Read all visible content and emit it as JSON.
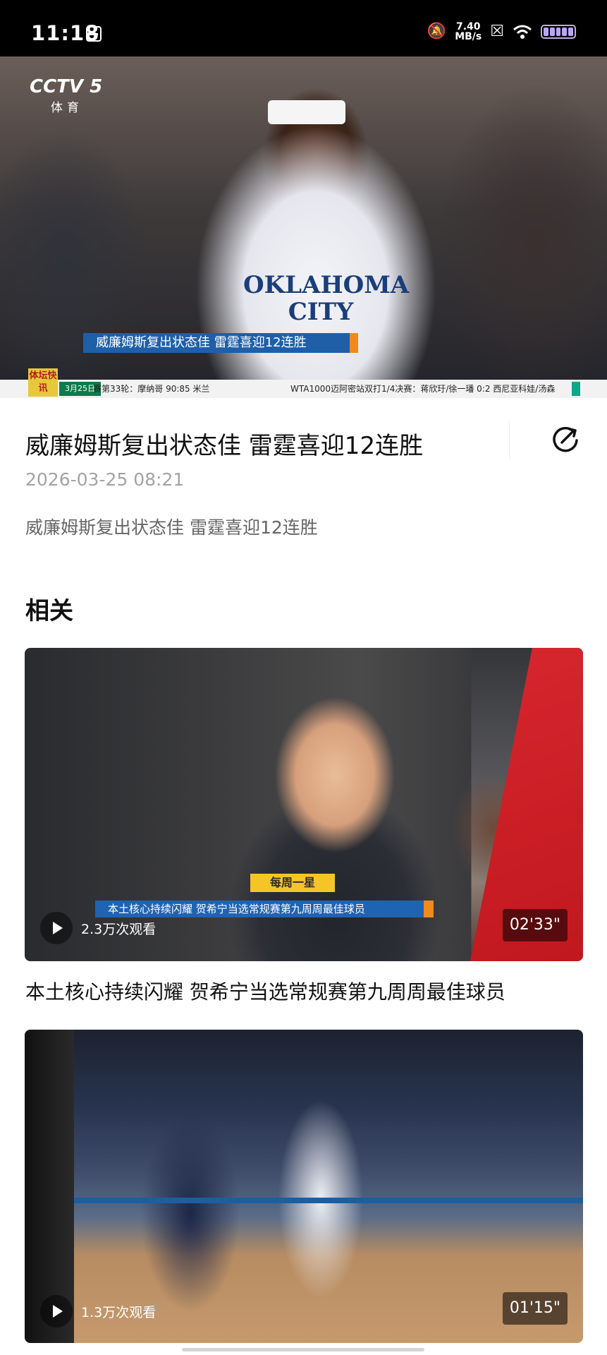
{
  "status_bar": {
    "time": "11:18",
    "net_speed_value": "7.40",
    "net_speed_unit": "MB/s",
    "icons": [
      "calendar-icon",
      "mute-icon",
      "x-app-icon",
      "wifi-icon",
      "battery-icon"
    ]
  },
  "hero_video": {
    "channel_logo": "CCTV 5",
    "channel_logo_sub": "体育",
    "jersey_text": [
      "OKLAHOMA",
      "CITY"
    ],
    "caption": "威廉姆斯复出状态佳  雷霆喜迎12连胜",
    "ticker": {
      "badge": "体坛快讯",
      "date": "3月25日",
      "left": "赛第33轮：摩纳哥 90:85 米兰",
      "right": "WTA1000迈阿密站双打1/4决赛：蒋欣玗/徐一璠 0:2 西尼亚科娃/汤森"
    }
  },
  "article": {
    "title": "威廉姆斯复出状态佳 雷霆喜迎12连胜",
    "date": "2026-03-25 08:21",
    "description": "威廉姆斯复出状态佳 雷霆喜迎12连胜"
  },
  "related": {
    "section_title": "相关",
    "items": [
      {
        "title": "本土核心持续闪耀 贺希宁当选常规赛第九周周最佳球员",
        "views": "2.3万次观看",
        "duration": "02'33\"",
        "overlay_badge": "每周一星",
        "overlay_caption": "本土核心持续闪耀  贺希宁当选常规赛第九周周最佳球员"
      },
      {
        "title": "",
        "views": "1.3万次观看",
        "duration": "01'15\""
      }
    ]
  },
  "colors": {
    "accent_blue": "#1f5fa8",
    "accent_orange": "#f08a1a",
    "muted_text": "#a3a3a3"
  }
}
